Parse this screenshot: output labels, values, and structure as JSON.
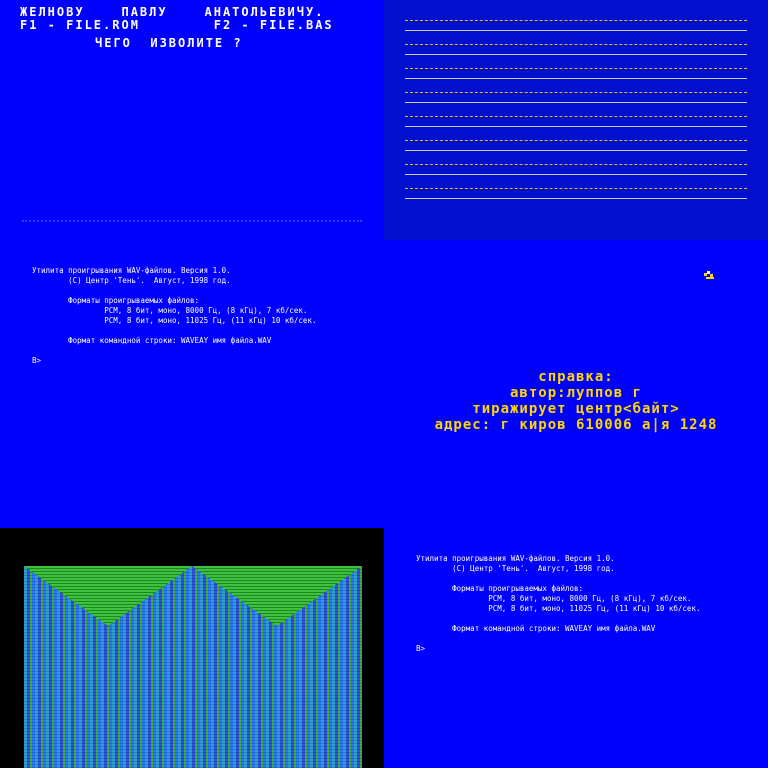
{
  "screen_a": {
    "line1": "ЖЕЛНОВУ    ПАВЛУ    АНАТОЛЬЕВИЧУ.",
    "line2": "F1 - FILE.ROM        F2 - FILE.BAS",
    "line3": "ЧЕГО  ИЗВОЛИТЕ ?"
  },
  "screen_c": {
    "lines": [
      "Утилита проигрывания WAV-файлов. Версия 1.0.",
      "        (C) Центр 'Тень'.  Август, 1998 год.",
      "",
      "        Форматы проигрываемых файлов:",
      "                PCM, 8 бит, моно, 8000 Гц, (8 кГц), 7 кб/сек.",
      "                PCM, 8 бит, моно, 11025 Гц, (11 кГц) 10 кб/сек.",
      "",
      "        Формат командной строки: WAVEAY имя файла.WAV",
      "",
      "B>"
    ]
  },
  "screen_d": {
    "l1": "справка:",
    "l2": "автор:луппов г",
    "l3": "тиражирует центр<байт>",
    "l4": "адрес: г киров 610006 а|я 1248"
  },
  "screen_f": {
    "lines": [
      "Утилита проигрывания WAV-файлов. Версия 1.0.",
      "        (C) Центр 'Тень'.  Август, 1998 год.",
      "",
      "        Форматы проигрываемых файлов:",
      "                PCM, 8 бит, моно, 8000 Гц, (8 кГц), 7 кб/сек.",
      "                PCM, 8 бит, моно, 11025 Гц, (11 кГц) 10 кб/сек.",
      "",
      "        Формат командной строки: WAVEAY имя файла.WAV",
      "",
      "B>"
    ]
  },
  "colors": {
    "zx_blue": "#0000ff",
    "help_yellow": "#ffd700",
    "pattern_green": "#40c040"
  }
}
